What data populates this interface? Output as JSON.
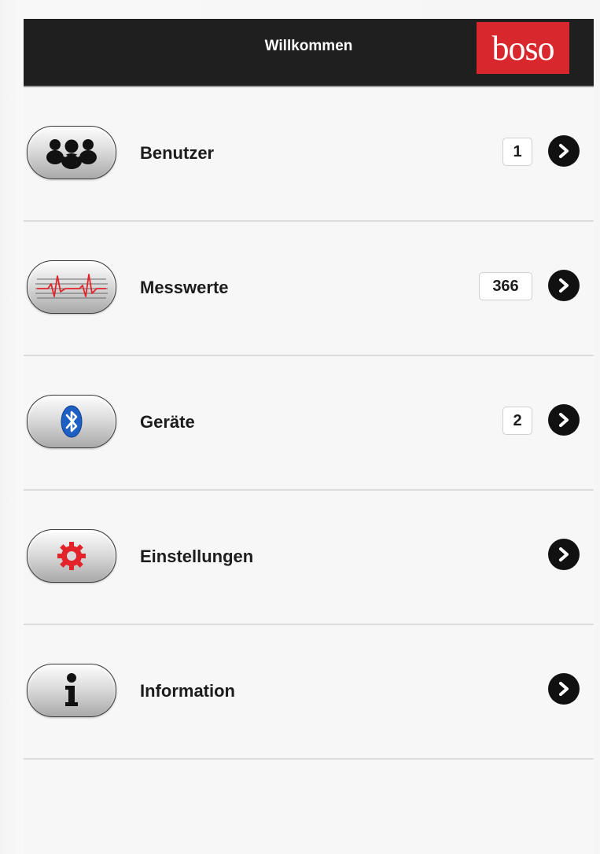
{
  "header": {
    "title": "Willkommen",
    "logo_text": "boso"
  },
  "menu": {
    "items": [
      {
        "label": "Benutzer",
        "badge": "1",
        "icon": "users-icon"
      },
      {
        "label": "Messwerte",
        "badge": "366",
        "icon": "ecg-waveform-icon"
      },
      {
        "label": "Geräte",
        "badge": "2",
        "icon": "bluetooth-icon"
      },
      {
        "label": "Einstellungen",
        "badge": "",
        "icon": "gear-icon"
      },
      {
        "label": "Information",
        "badge": "",
        "icon": "info-icon"
      }
    ]
  },
  "colors": {
    "header_bg": "#1f1f1f",
    "logo_bg": "#d9272e",
    "accent_red": "#e2232a",
    "bluetooth_blue": "#1d5fc2"
  }
}
